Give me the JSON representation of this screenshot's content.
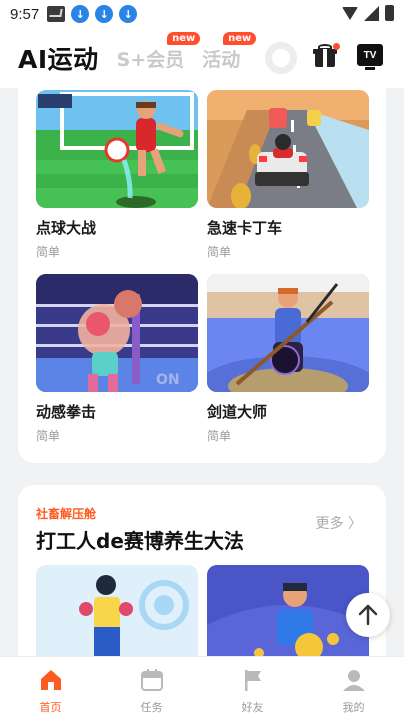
{
  "status": {
    "time": "9:57"
  },
  "header": {
    "app_title": "AI运动",
    "tabs": [
      {
        "label": "S+会员",
        "badge": "new"
      },
      {
        "label": "活动",
        "badge": "new"
      }
    ],
    "tv_label": "TV"
  },
  "games": [
    {
      "name": "点球大战",
      "level": "简单"
    },
    {
      "name": "急速卡丁车",
      "level": "简单"
    },
    {
      "name": "动感拳击",
      "level": "简单"
    },
    {
      "name": "剑道大师",
      "level": "简单"
    }
  ],
  "section": {
    "tag": "社畜解压舱",
    "title": "打工人de赛博养生大法",
    "more": "更多 〉"
  },
  "nav": [
    {
      "label": "首页",
      "icon": "home-icon"
    },
    {
      "label": "任务",
      "icon": "calendar-icon"
    },
    {
      "label": "好友",
      "icon": "flag-icon"
    },
    {
      "label": "我的",
      "icon": "user-icon"
    }
  ],
  "colors": {
    "accent": "#ff5a1f",
    "badge": "#ff4d2e",
    "download": "#2a84e6"
  }
}
